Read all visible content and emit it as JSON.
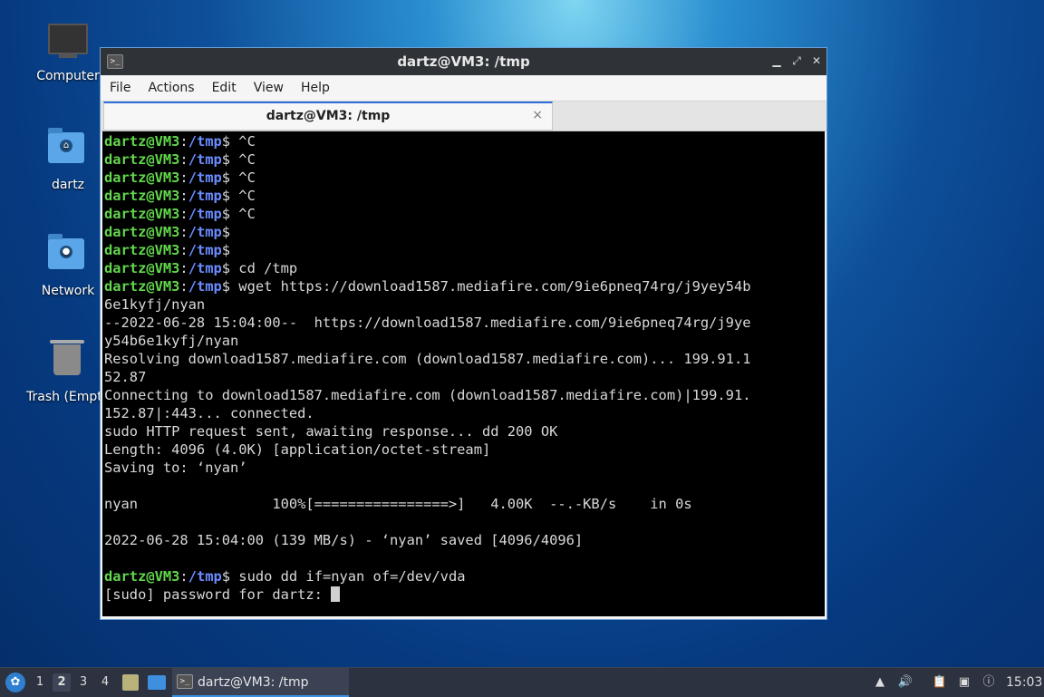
{
  "desktop": {
    "icons": [
      {
        "label": "Computer"
      },
      {
        "label": "dartz"
      },
      {
        "label": "Network"
      },
      {
        "label": "Trash (Empt"
      }
    ]
  },
  "window": {
    "title": "dartz@VM3: /tmp",
    "menu": [
      "File",
      "Actions",
      "Edit",
      "View",
      "Help"
    ],
    "tab_label": "dartz@VM3: /tmp",
    "tab_close": "×",
    "btn_min": "▁",
    "btn_max": "⤢",
    "btn_close": "✕"
  },
  "terminal": {
    "user": "dartz@VM3",
    "lines": [
      {
        "u": "dartz@VM3",
        "c": ":",
        "p": "/tmp",
        "t": "$ ^C"
      },
      {
        "u": "dartz@VM3",
        "c": ":",
        "p": "/tmp",
        "t": "$ ^C"
      },
      {
        "u": "dartz@VM3",
        "c": ":",
        "p": "/tmp",
        "t": "$ ^C"
      },
      {
        "u": "dartz@VM3",
        "c": ":",
        "p": "/tmp",
        "t": "$ ^C"
      },
      {
        "u": "dartz@VM3",
        "c": ":",
        "p": "/tmp",
        "t": "$ ^C"
      },
      {
        "u": "dartz@VM3",
        "c": ":",
        "p": "/tmp",
        "t": "$"
      },
      {
        "u": "dartz@VM3",
        "c": ":",
        "p": "/tmp",
        "t": "$"
      },
      {
        "u": "dartz@VM3",
        "c": ":",
        "p": "/tmp",
        "t": "$ cd /tmp"
      },
      {
        "u": "dartz@VM3",
        "c": ":",
        "p": "/tmp",
        "t": "$ wget https://download1587.mediafire.com/9ie6pneq74rg/j9yey54b"
      },
      {
        "t": "6e1kyfj/nyan"
      },
      {
        "t": "--2022-06-28 15:04:00--  https://download1587.mediafire.com/9ie6pneq74rg/j9ye"
      },
      {
        "t": "y54b6e1kyfj/nyan"
      },
      {
        "t": "Resolving download1587.mediafire.com (download1587.mediafire.com)... 199.91.1"
      },
      {
        "t": "52.87"
      },
      {
        "t": "Connecting to download1587.mediafire.com (download1587.mediafire.com)|199.91."
      },
      {
        "t": "152.87|:443... connected."
      },
      {
        "t": "sudo HTTP request sent, awaiting response... dd 200 OK"
      },
      {
        "t": "Length: 4096 (4.0K) [application/octet-stream]"
      },
      {
        "t": "Saving to: ‘nyan’"
      },
      {
        "t": ""
      },
      {
        "t": "nyan                100%[================>]   4.00K  --.-KB/s    in 0s"
      },
      {
        "t": ""
      },
      {
        "t": "2022-06-28 15:04:00 (139 MB/s) - ‘nyan’ saved [4096/4096]"
      },
      {
        "t": ""
      },
      {
        "u": "dartz@VM3",
        "c": ":",
        "p": "/tmp",
        "t": "$ sudo dd if=nyan of=/dev/vda"
      },
      {
        "t": "[sudo] password for dartz: ",
        "cursor": true
      }
    ]
  },
  "taskbar": {
    "workspaces": [
      "1",
      "2",
      "3",
      "4"
    ],
    "active_workspace": "2",
    "task_label": "dartz@VM3: /tmp",
    "clock": "15:03"
  }
}
